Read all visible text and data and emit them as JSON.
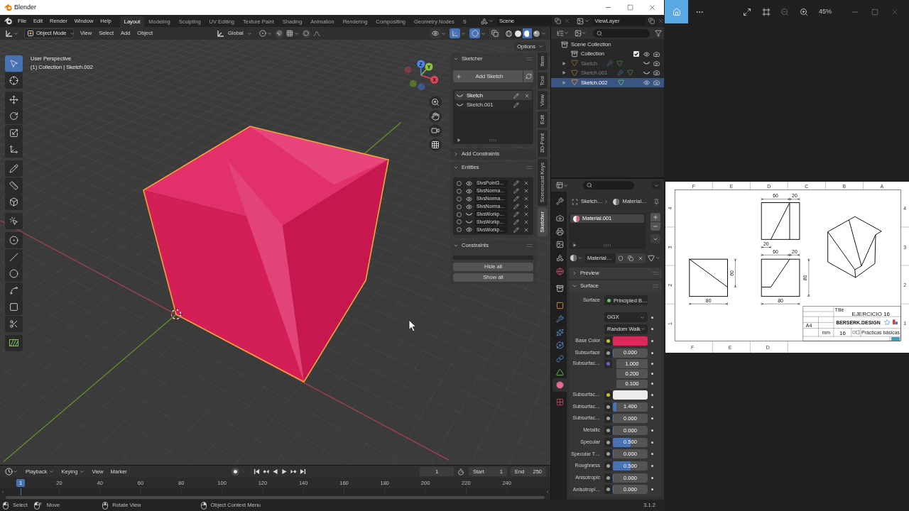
{
  "window": {
    "title": "Blender"
  },
  "topbar": {
    "menus": [
      "File",
      "Edit",
      "Render",
      "Window",
      "Help"
    ],
    "workspaces": [
      {
        "label": "Layout",
        "selected": true
      },
      {
        "label": "Modeling",
        "selected": false
      },
      {
        "label": "Sculpting",
        "selected": false
      },
      {
        "label": "UV Editing",
        "selected": false
      },
      {
        "label": "Texture Paint",
        "selected": false
      },
      {
        "label": "Shading",
        "selected": false
      },
      {
        "label": "Animation",
        "selected": false
      },
      {
        "label": "Rendering",
        "selected": false
      },
      {
        "label": "Compositing",
        "selected": false
      },
      {
        "label": "Geometry Nodes",
        "selected": false
      },
      {
        "label": "S",
        "selected": false
      }
    ],
    "scene": "Scene",
    "view_layer": "ViewLayer"
  },
  "viewport": {
    "header": {
      "mode": "Object Mode",
      "menus": [
        "View",
        "Select",
        "Add",
        "Object"
      ],
      "orientation": "Global",
      "toggles": [
        {
          "kind": "snap",
          "on": false
        },
        {
          "kind": "proportional",
          "on": false
        }
      ],
      "overlays": [
        {
          "kind": "visibility",
          "on": false
        },
        {
          "kind": "gizmo",
          "on": true
        },
        {
          "kind": "overlay",
          "on": true
        },
        {
          "kind": "xray",
          "on": false
        }
      ],
      "shading": [
        {
          "kind": "wireframe",
          "selected": false
        },
        {
          "kind": "solid",
          "selected": false
        },
        {
          "kind": "material",
          "selected": true
        },
        {
          "kind": "rendered",
          "selected": false
        }
      ]
    },
    "info": [
      "User Perspective",
      "(1) Collection | Sketch.002"
    ],
    "gizmo": {
      "labels": [
        "X",
        "Y",
        "Z"
      ]
    },
    "tools": [
      {
        "kind": "select_box",
        "selected": true
      },
      {
        "kind": "cursor",
        "selected": false
      },
      {
        "kind": "move",
        "selected": false,
        "gap": true
      },
      {
        "kind": "rotate",
        "selected": false
      },
      {
        "kind": "scale",
        "selected": false
      },
      {
        "kind": "transform",
        "selected": false
      },
      {
        "kind": "annotate",
        "selected": false,
        "gap": true
      },
      {
        "kind": "measure",
        "selected": false
      },
      {
        "kind": "add_cube",
        "selected": false
      },
      {
        "kind": "sketch_select",
        "selected": false,
        "gap": true
      },
      {
        "kind": "point",
        "selected": false,
        "gap": true
      },
      {
        "kind": "line",
        "selected": false
      },
      {
        "kind": "circle",
        "selected": false
      },
      {
        "kind": "arc",
        "selected": false
      },
      {
        "kind": "rectangle",
        "selected": false
      },
      {
        "kind": "trim",
        "selected": false
      },
      {
        "kind": "hatch",
        "selected": false,
        "gap": true
      }
    ],
    "options": "Options",
    "sidebar": {
      "panels": [
        {
          "kind": "sketches",
          "title": "Sketcher",
          "expanded": true,
          "button": "Add Sketch",
          "items": [
            {
              "name": "Sketch",
              "visible": false,
              "selected": true
            },
            {
              "name": "Sketch.001",
              "visible": false,
              "selected": false
            }
          ]
        },
        {
          "title": "Add Constraints",
          "expanded": false
        },
        {
          "kind": "entities",
          "title": "Entities",
          "expanded": true,
          "items": [
            {
              "name": "SlvsPoint3…",
              "visible": true,
              "selected": false
            },
            {
              "name": "SlvsNorma…",
              "visible": true,
              "selected": false
            },
            {
              "name": "SlvsNorma…",
              "visible": true,
              "selected": false
            },
            {
              "name": "SlvsNorma…",
              "visible": true,
              "selected": false
            },
            {
              "name": "SlvsWorkp…",
              "visible": false,
              "selected": false
            },
            {
              "name": "SlvsWorkp…",
              "visible": false,
              "selected": false
            },
            {
              "name": "SlvsWorkp…",
              "visible": true,
              "selected": false
            }
          ]
        },
        {
          "kind": "constraints",
          "title": "Constraints",
          "expanded": true,
          "buttons": [
            "Hide all",
            "Show all"
          ]
        }
      ],
      "tabs": [
        {
          "label": "Item",
          "selected": false
        },
        {
          "label": "Tool",
          "selected": false
        },
        {
          "label": "View",
          "selected": false
        },
        {
          "label": "Edit",
          "selected": false
        },
        {
          "label": "3D-Print",
          "selected": false
        },
        {
          "label": "Screencast Keys",
          "selected": false
        },
        {
          "label": "Sketcher",
          "selected": true
        }
      ]
    }
  },
  "outliner": {
    "tree": [
      {
        "kind": "scene",
        "name": "Scene Collection",
        "children": [
          {
            "kind": "collection",
            "name": "Collection",
            "checked": true,
            "visible": true,
            "children": [
              {
                "kind": "object",
                "name": "Sketch",
                "expanded": false,
                "visible": false,
                "selected": false,
                "modifier": true
              },
              {
                "kind": "object",
                "name": "Sketch.001",
                "expanded": false,
                "visible": false,
                "selected": false,
                "modifier": true
              },
              {
                "kind": "object",
                "name": "Sketch.002",
                "expanded": false,
                "visible": true,
                "selected": true,
                "modifier": false
              }
            ]
          }
        ]
      }
    ]
  },
  "properties": {
    "tabs": [
      {
        "kind": "tool",
        "selected": false
      },
      {
        "kind": "render",
        "selected": false
      },
      {
        "kind": "output",
        "selected": false
      },
      {
        "kind": "view_layer",
        "selected": false
      },
      {
        "kind": "scene",
        "selected": false
      },
      {
        "kind": "world",
        "selected": false
      },
      {
        "kind": "collection",
        "selected": false
      },
      {
        "kind": "object",
        "selected": false
      },
      {
        "kind": "modifiers",
        "selected": false
      },
      {
        "kind": "particles",
        "selected": false
      },
      {
        "kind": "physics",
        "selected": false
      },
      {
        "kind": "constraints",
        "selected": false
      },
      {
        "kind": "data",
        "selected": false
      },
      {
        "kind": "material",
        "selected": true
      },
      {
        "kind": "texture",
        "selected": false
      }
    ],
    "breadcrumb": [
      "Sketch…",
      "Material…"
    ],
    "slots": [
      {
        "name": "Material.001",
        "selected": true
      }
    ],
    "material": "Material…",
    "panels": [
      {
        "title": "Preview",
        "expanded": false
      },
      {
        "title": "Surface",
        "expanded": true,
        "shader_label": "Surface",
        "shader": "Principled B…",
        "inputs": [
          {
            "kind": "enum",
            "value": "GGX"
          },
          {
            "kind": "enum",
            "value": "Random Walk"
          },
          {
            "kind": "color",
            "label": "Base Color",
            "socket": {
              "color": "#c7c729"
            },
            "color": "#e3265a"
          },
          {
            "kind": "slider",
            "label": "Subsurface",
            "socket": {
              "color": "#a1a1a1"
            },
            "value": "0.000",
            "level": 0
          },
          {
            "kind": "vector",
            "label": "Subsurfac…",
            "socket": {
              "color": "#6363c7"
            },
            "values": [
              "1.000",
              "0.200",
              "0.100"
            ]
          },
          {
            "kind": "color",
            "label": "Subsurfac…",
            "socket": {
              "color": "#c7c729"
            },
            "color": "#ececec"
          },
          {
            "kind": "slider",
            "label": "Subsurfac…",
            "socket": {
              "color": "#a1a1a1"
            },
            "value": "1.400",
            "level": 0.1
          },
          {
            "kind": "slider",
            "label": "Subsurfac…",
            "socket": {
              "color": "#a1a1a1"
            },
            "value": "0.000",
            "level": 0
          },
          {
            "kind": "slider",
            "label": "Metallic",
            "socket": {
              "color": "#a1a1a1"
            },
            "value": "0.000",
            "level": 0
          },
          {
            "kind": "slider",
            "label": "Specular",
            "socket": {
              "color": "#a1a1a1"
            },
            "value": "0.500",
            "level": 0.5
          },
          {
            "kind": "slider",
            "label": "Specular T…",
            "socket": {
              "color": "#a1a1a1"
            },
            "value": "0.000",
            "level": 0
          },
          {
            "kind": "slider",
            "label": "Roughness",
            "socket": {
              "color": "#a1a1a1"
            },
            "value": "0.500",
            "level": 0.5
          },
          {
            "kind": "slider",
            "label": "Anisotropic",
            "socket": {
              "color": "#a1a1a1"
            },
            "value": "0.000",
            "level": 0
          },
          {
            "kind": "slider",
            "label": "Anisotropi…",
            "socket": {
              "color": "#a1a1a1"
            },
            "value": "0.000",
            "level": 0
          }
        ]
      }
    ]
  },
  "timeline": {
    "menus": [
      {
        "label": "Playback",
        "dropdown": true
      },
      {
        "label": "Keying",
        "dropdown": true
      },
      {
        "label": "View",
        "dropdown": false
      },
      {
        "label": "Marker",
        "dropdown": false
      }
    ],
    "frame": "1",
    "start": {
      "label": "Start",
      "value": "1"
    },
    "end": {
      "label": "End",
      "value": "250"
    },
    "current": "1",
    "ticks": [
      "20",
      "40",
      "60",
      "80",
      "100",
      "120",
      "140",
      "160",
      "180",
      "200",
      "220",
      "240"
    ]
  },
  "status": {
    "hints": [
      {
        "kind": "left_click",
        "label": "Select"
      },
      {
        "kind": "drag",
        "label": "Move"
      },
      {
        "kind": "middle_click",
        "label": "Rotate View"
      },
      {
        "kind": "right_click",
        "label": "Object Context Menu"
      }
    ],
    "version": "3.1.2"
  },
  "viewer": {
    "zoom": "45%",
    "drawing": {
      "top_letters": [
        "F",
        "E",
        "D",
        "C",
        "B",
        "A"
      ],
      "bottom_letters": [
        "F",
        "E",
        "D"
      ],
      "left_numbers": [
        "4",
        "3",
        "2",
        "1"
      ],
      "right_numbers": [
        "4",
        "3",
        "2",
        "1"
      ],
      "views": [
        {
          "kind": "top",
          "dims": [
            "60",
            "20",
            "20"
          ]
        },
        {
          "kind": "front",
          "dims": [
            "60",
            "20",
            "80",
            "80"
          ]
        },
        {
          "kind": "side",
          "dims": [
            "60",
            "80"
          ]
        },
        {
          "kind": "isometric"
        }
      ],
      "title_block": {
        "label": "Title",
        "title": "EJERCICIO 16",
        "size": "A4",
        "brand": "BERSERK.DESIGN",
        "unit": "mm",
        "sheet": "16",
        "subject": "Prácticas básicas"
      }
    }
  }
}
